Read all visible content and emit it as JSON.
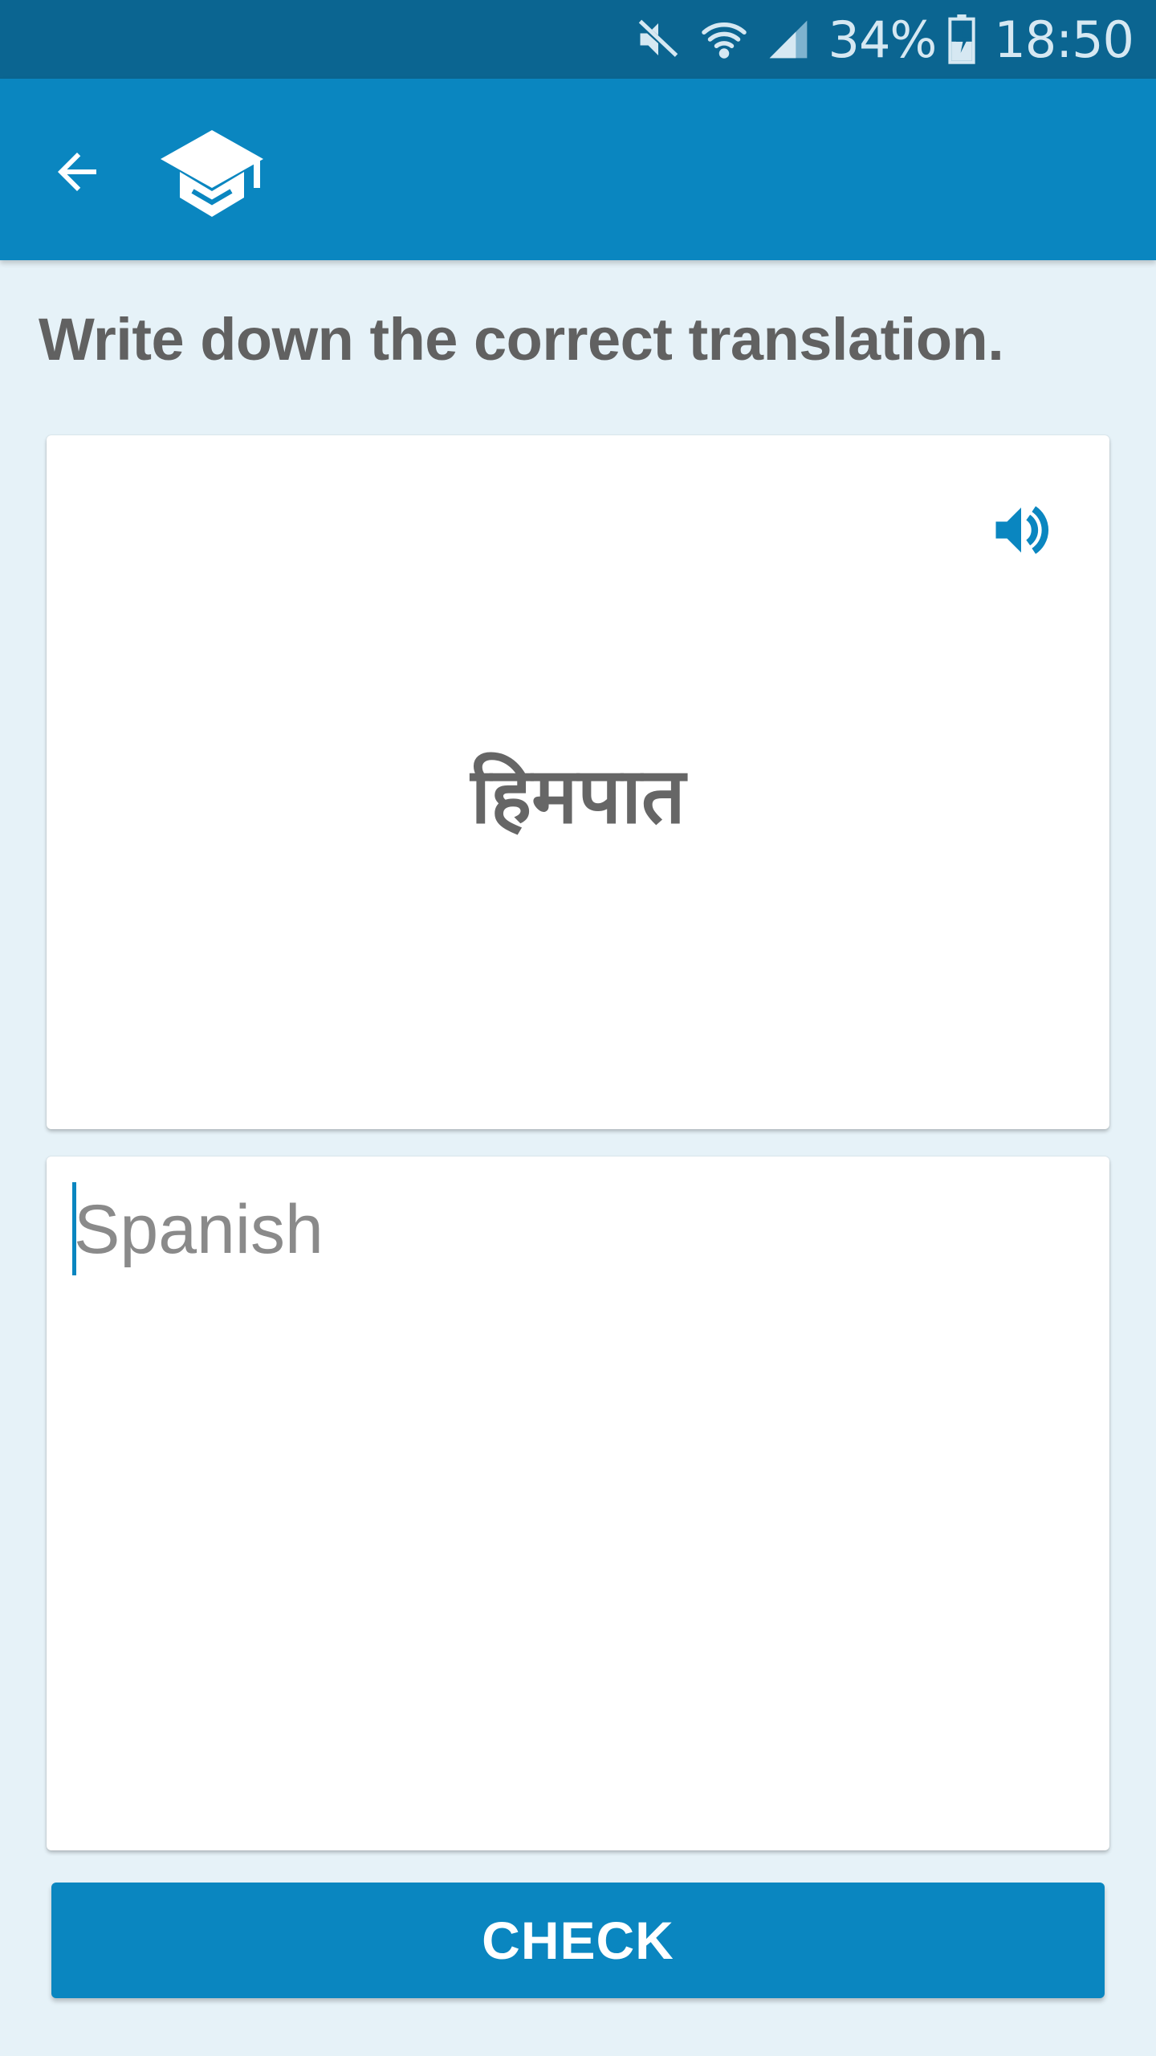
{
  "status_bar": {
    "battery": "34%",
    "time": "18:50",
    "icons": [
      "mute-icon",
      "wifi-icon",
      "signal-icon",
      "battery-charging-icon"
    ]
  },
  "app_bar": {
    "back_icon": "arrow-left-icon",
    "logo_icon": "graduation-cap-icon",
    "background": "#0a86c0"
  },
  "exercise": {
    "instruction": "Write down the correct translation.",
    "word": "हिमपात",
    "speaker_icon": "speaker-icon"
  },
  "answer": {
    "placeholder": "Spanish",
    "value": ""
  },
  "actions": {
    "check_label": "CHECK"
  },
  "colors": {
    "primary": "#0a86c0",
    "status_bar": "#0b6591",
    "background": "#e6f2f8",
    "text_gray": "#616161"
  }
}
